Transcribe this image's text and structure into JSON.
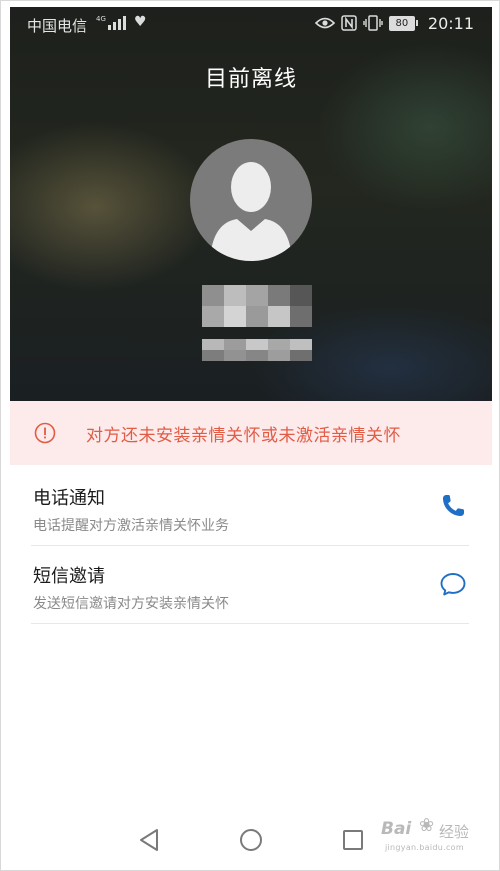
{
  "status_bar": {
    "carrier": "中国电信",
    "network": "4G",
    "battery": "80",
    "time": "20:11"
  },
  "call": {
    "title": "目前离线"
  },
  "banner": {
    "text": "对方还未安装亲情关怀或未激活亲情关怀",
    "color": "#e25b45",
    "background": "#fdeaea"
  },
  "options": [
    {
      "title": "电话通知",
      "desc": "电话提醒对方激活亲情关怀业务",
      "icon": "phone-icon"
    },
    {
      "title": "短信邀请",
      "desc": "发送短信邀请对方安装亲情关怀",
      "icon": "chat-bubble-icon"
    }
  ],
  "accent_color": "#1f6fc4",
  "watermark": {
    "main": "Bai",
    "jingyan": "经验",
    "sub": "jingyan.baidu.com"
  }
}
